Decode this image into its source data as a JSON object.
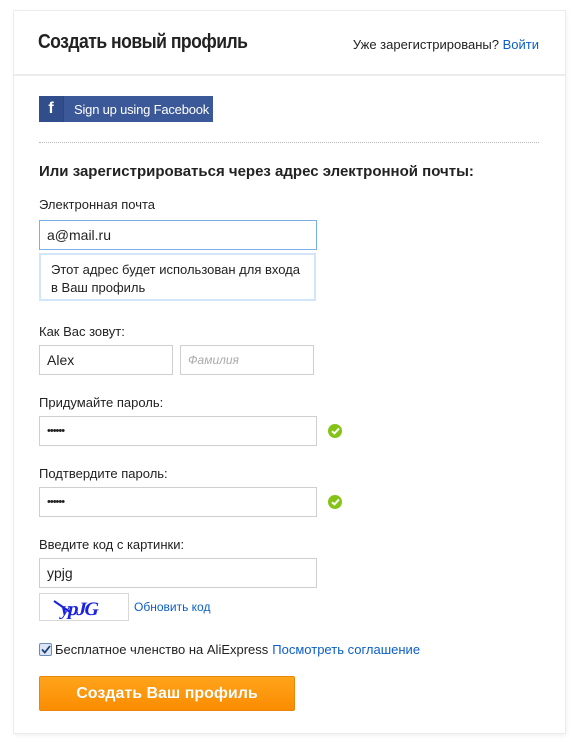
{
  "header": {
    "title": "Создать новый профиль",
    "already_registered": "Уже зарегистрированы?",
    "login_link": "Войти"
  },
  "facebook": {
    "icon": "facebook-f-icon",
    "label": "Sign up using Facebook",
    "color": "#3b5998"
  },
  "form": {
    "section_title": "Или зарегистрироваться через адрес электронной почты:",
    "email": {
      "label": "Электронная почта",
      "value": "a@mail.ru",
      "hint": "Этот адрес будет использован для входа в Ваш профиль"
    },
    "name": {
      "label": "Как Вас зовут:",
      "first_value": "Alex",
      "last_placeholder": "Фамилия"
    },
    "password": {
      "label": "Придумайте пароль:",
      "value": "••••••",
      "status_icon": "check-circle-icon"
    },
    "confirm_password": {
      "label": "Подтвердите пароль:",
      "value": "••••••",
      "status_icon": "check-circle-icon"
    },
    "captcha": {
      "label": "Введите код с картинки:",
      "value": "ypjg",
      "image_text": "ypJG",
      "refresh_link": "Обновить код"
    },
    "agreement": {
      "checked": true,
      "text": "Бесплатное членство на AliExpress",
      "link": "Посмотреть соглашение"
    },
    "submit_label": "Создать Ваш профиль"
  },
  "colors": {
    "link": "#0b5ec8",
    "success": "#86c317",
    "submit": "#fb8c00"
  }
}
